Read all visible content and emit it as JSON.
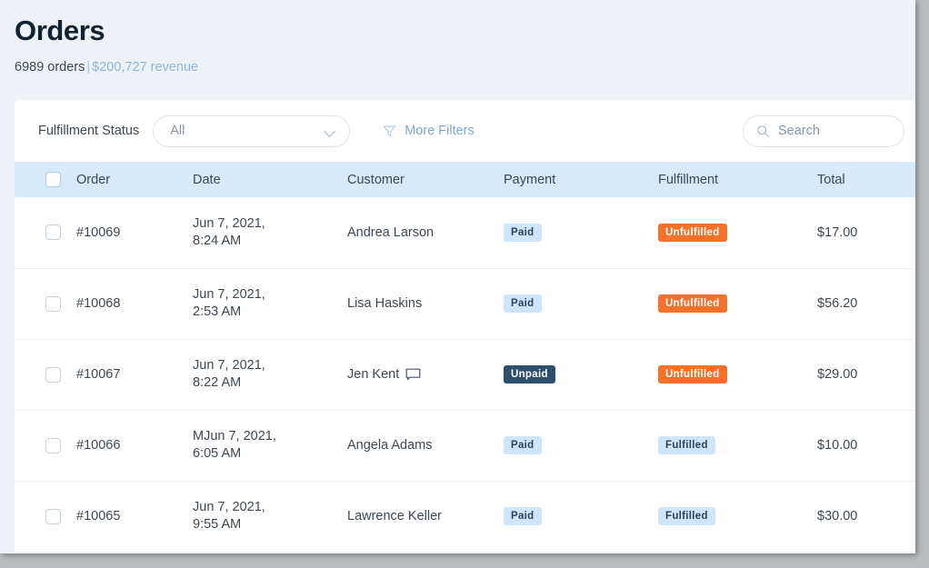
{
  "header": {
    "title": "Orders",
    "order_count_text": "6989 orders",
    "separator": "|",
    "revenue_text": "$200,727 revenue"
  },
  "filters": {
    "fulfillment_label": "Fulfillment Status",
    "fulfillment_value": "All",
    "fulfillment_options": [
      "All"
    ],
    "more_filters_label": "More Filters",
    "filter_icon": "funnel-icon",
    "chevron_icon": "chevron-down-icon"
  },
  "search": {
    "placeholder": "Search",
    "value": "",
    "icon": "search-icon"
  },
  "table": {
    "columns": [
      "Order",
      "Date",
      "Customer",
      "Payment",
      "Fulfillment",
      "Total"
    ],
    "select_all_checked": false,
    "rows": [
      {
        "checked": false,
        "order": "#10069",
        "date_line1": "Jun 7, 2021,",
        "date_line2": "8:24 AM",
        "customer": "Andrea Larson",
        "has_comment": false,
        "payment": "Paid",
        "payment_style": "paid",
        "fulfillment": "Unfulfilled",
        "fulfillment_style": "unfulfilled",
        "total": "$17.00"
      },
      {
        "checked": false,
        "order": "#10068",
        "date_line1": "Jun 7, 2021,",
        "date_line2": "2:53 AM",
        "customer": "Lisa Haskins",
        "has_comment": false,
        "payment": "Paid",
        "payment_style": "paid",
        "fulfillment": "Unfulfilled",
        "fulfillment_style": "unfulfilled",
        "total": "$56.20"
      },
      {
        "checked": false,
        "order": "#10067",
        "date_line1": "Jun 7, 2021,",
        "date_line2": "8:22 AM",
        "customer": "Jen Kent",
        "has_comment": true,
        "payment": "Unpaid",
        "payment_style": "unpaid",
        "fulfillment": "Unfulfilled",
        "fulfillment_style": "unfulfilled",
        "total": "$29.00"
      },
      {
        "checked": false,
        "order": "#10066",
        "date_line1": "MJun 7, 2021,",
        "date_line2": "6:05 AM",
        "customer": "Angela Adams",
        "has_comment": false,
        "payment": "Paid",
        "payment_style": "paid",
        "fulfillment": "Fulfilled",
        "fulfillment_style": "fulfilled",
        "total": "$10.00"
      },
      {
        "checked": false,
        "order": "#10065",
        "date_line1": "Jun 7, 2021,",
        "date_line2": "9:55 AM",
        "customer": "Lawrence Keller",
        "has_comment": false,
        "payment": "Paid",
        "payment_style": "paid",
        "fulfillment": "Fulfilled",
        "fulfillment_style": "fulfilled",
        "total": "$30.00"
      }
    ]
  },
  "colors": {
    "page_background": "#eef1f5",
    "title": "#132233",
    "accent_blue": "#8fb5d9",
    "header_row": "#d7eafb",
    "badge_paid_bg": "#cfe6fa",
    "badge_unpaid_bg": "#2e4f6b",
    "badge_unfulfilled_bg": "#f2722c",
    "badge_fulfilled_bg": "#cfe6fa"
  }
}
